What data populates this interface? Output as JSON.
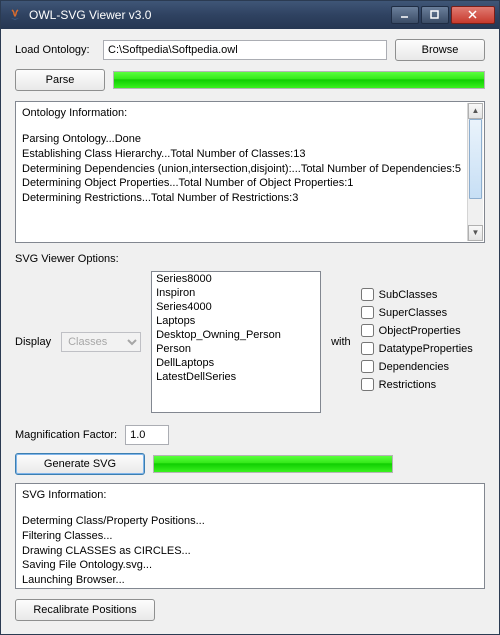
{
  "window": {
    "title": "OWL-SVG Viewer v3.0"
  },
  "load": {
    "label": "Load Ontology:",
    "path": "C:\\Softpedia\\Softpedia.owl",
    "browse": "Browse",
    "parse": "Parse"
  },
  "ontology_info": {
    "header": "Ontology Information:",
    "lines": [
      "Parsing Ontology...Done",
      "Establishing Class Hierarchy...Total Number of Classes:13",
      "Determining Dependencies (union,intersection,disjoint):...Total Number of Dependencies:5",
      "Determining Object Properties...Total Number of Object Properties:1",
      "Determining Restrictions...Total Number of Restrictions:3"
    ]
  },
  "svg_options": {
    "label": "SVG Viewer Options:",
    "display_label": "Display",
    "display_value": "Classes",
    "with_label": "with",
    "items": [
      "Series8000",
      "Inspiron",
      "Series4000",
      "Laptops",
      "Desktop_Owning_Person",
      "Person",
      "DellLaptops",
      "LatestDellSeries"
    ],
    "checks": [
      "SubClasses",
      "SuperClasses",
      "ObjectProperties",
      "DatatypeProperties",
      "Dependencies",
      "Restrictions"
    ]
  },
  "mag": {
    "label": "Magnification Factor:",
    "value": "1.0"
  },
  "generate": {
    "button": "Generate SVG"
  },
  "svg_info": {
    "header": "SVG Information:",
    "lines": [
      "Determing Class/Property Positions...",
      "Filtering Classes...",
      "Drawing CLASSES as CIRCLES...",
      "Saving File Ontology.svg...",
      "Launching Browser..."
    ]
  },
  "recalibrate": "Recalibrate Positions"
}
